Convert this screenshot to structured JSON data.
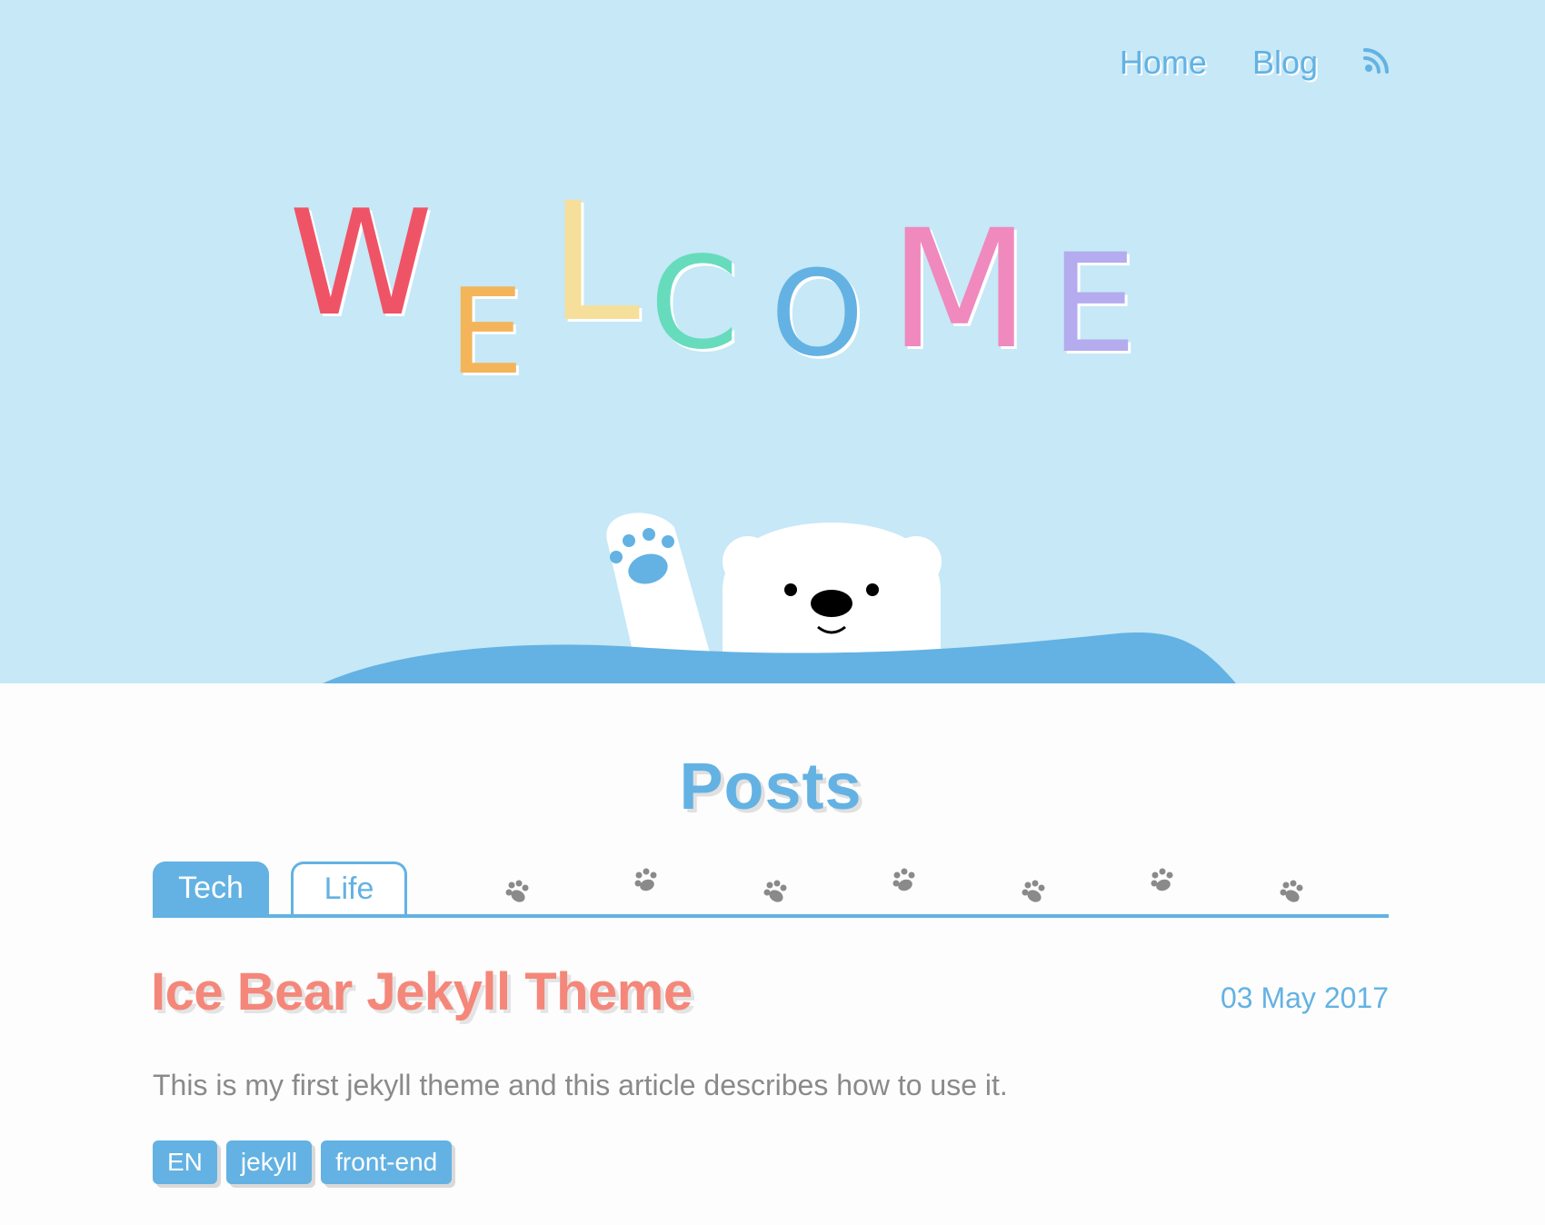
{
  "nav": {
    "home_label": "Home",
    "blog_label": "Blog",
    "rss_icon": "rss-icon"
  },
  "hero": {
    "welcome_letters": [
      {
        "char": "W",
        "color": "#ef5466"
      },
      {
        "char": "E",
        "color": "#f4b45a"
      },
      {
        "char": "L",
        "color": "#f6df9a"
      },
      {
        "char": "C",
        "color": "#66dcbc"
      },
      {
        "char": "O",
        "color": "#63b2e3"
      },
      {
        "char": "M",
        "color": "#ef89be"
      },
      {
        "char": "E",
        "color": "#b5abef"
      }
    ],
    "bear_icon": "waving-polar-bear",
    "water_color": "#63b2e3",
    "background_color": "#c6e8f7"
  },
  "posts": {
    "heading": "Posts",
    "tabs": [
      {
        "label": "Tech",
        "active": true
      },
      {
        "label": "Life",
        "active": false
      }
    ],
    "paw_icon": "paw-print-icon",
    "items": [
      {
        "title": "Ice Bear Jekyll Theme",
        "date": "03 May 2017",
        "excerpt": "This is my first jekyll theme and this article describes how to use it.",
        "tags": [
          "EN",
          "jekyll",
          "front-end"
        ]
      }
    ]
  },
  "colors": {
    "accent": "#63b2e3",
    "title": "#f4877a",
    "text": "#8a8a8a"
  }
}
